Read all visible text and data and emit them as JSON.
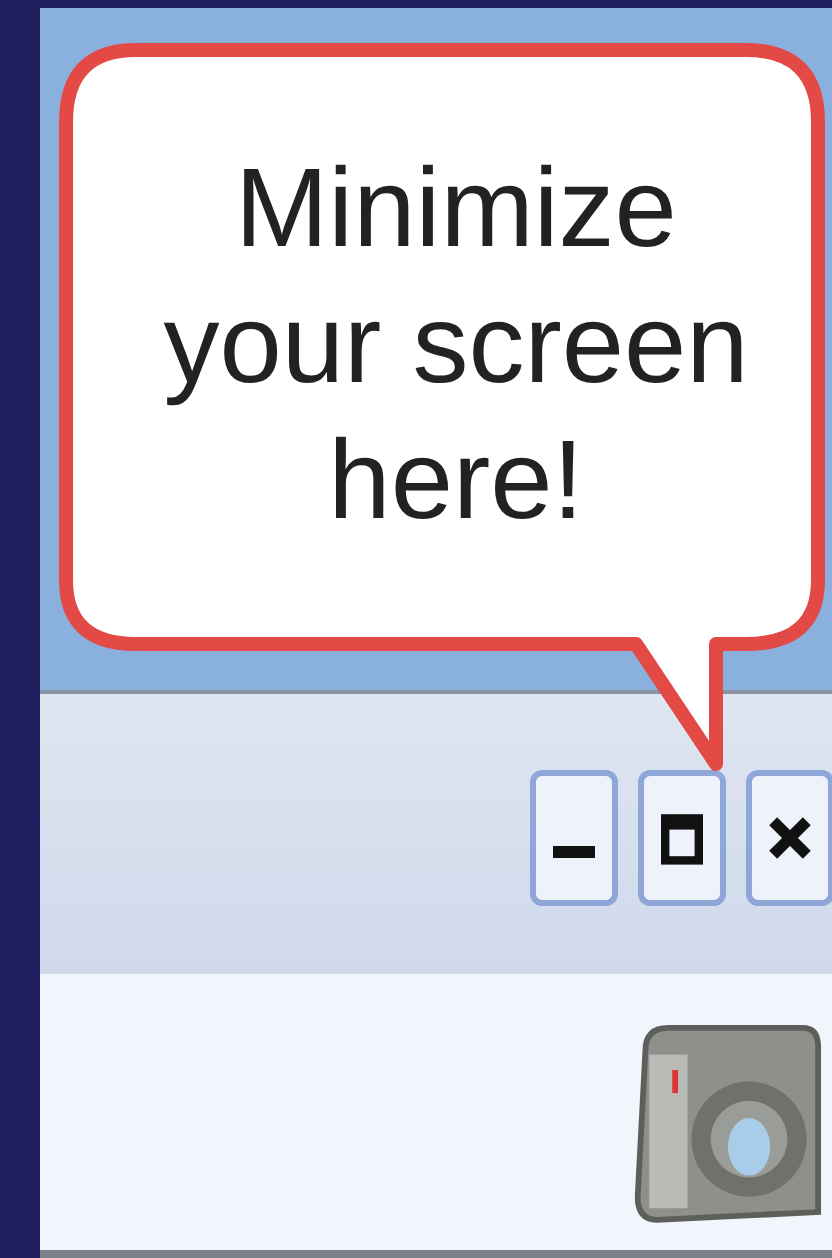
{
  "callout": {
    "text": "Minimize your screen here!"
  },
  "window_controls": [
    {
      "kind": "minimize"
    },
    {
      "kind": "maximize"
    },
    {
      "kind": "close"
    }
  ]
}
